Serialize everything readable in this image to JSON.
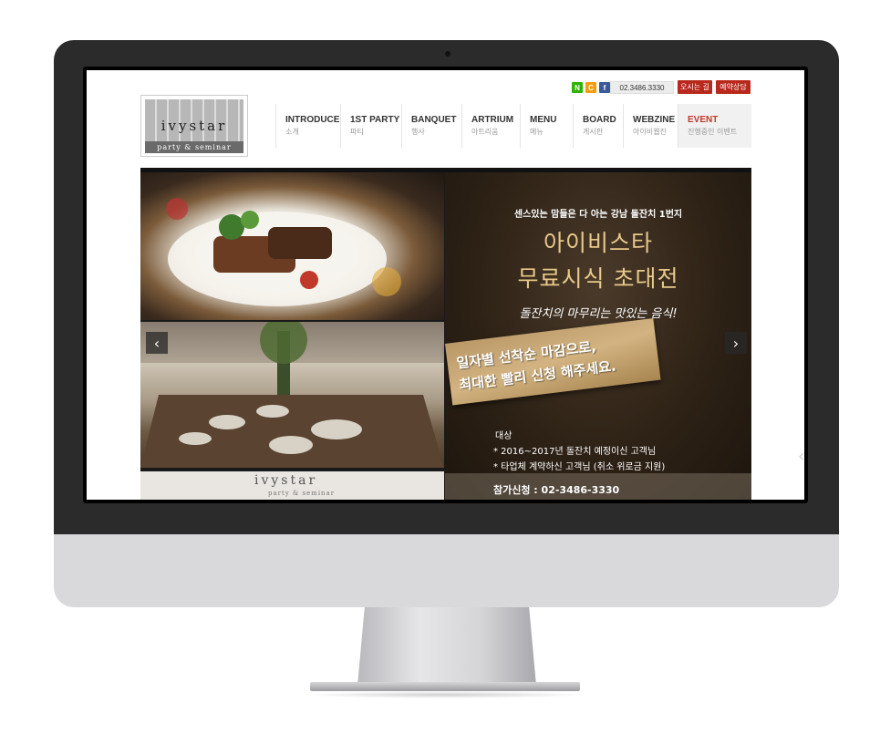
{
  "util": {
    "social": [
      {
        "label": "N",
        "icon": "naver-icon",
        "color": "#2db400"
      },
      {
        "label": "C",
        "icon": "cafe-icon",
        "color": "#f39c12"
      },
      {
        "label": "f",
        "icon": "facebook-icon",
        "color": "#3b5998"
      }
    ],
    "phone": "02.3486.3330",
    "directions_label": "오시는 길",
    "reservation_label": "예약상담"
  },
  "logo": {
    "wordmark": "ivystar",
    "tagline": "party & seminar"
  },
  "nav": [
    {
      "en": "INTRODUCE",
      "ko": "소개"
    },
    {
      "en": "1ST PARTY",
      "ko": "파티"
    },
    {
      "en": "BANQUET",
      "ko": "행사"
    },
    {
      "en": "ARTRIUM",
      "ko": "아트리움"
    },
    {
      "en": "MENU",
      "ko": "메뉴"
    },
    {
      "en": "BOARD",
      "ko": "게시판"
    },
    {
      "en": "WEBZINE",
      "ko": "아이비웹진"
    },
    {
      "en": "EVENT",
      "ko": "진행중인 이벤트"
    }
  ],
  "banner": {
    "headline_small": "센스있는 맘들은 다 아는 강남 돌잔치 1번지",
    "title_line1": "아이비스타",
    "title_line2": "무료시식 초대전",
    "subtitle": "돌잔치의 마무리는 맛있는 음식!",
    "ribbon_line1": "일자별 선착순 마감으로,",
    "ribbon_line2": "최대한 빨리 신청 해주세요.",
    "target_label": "대상",
    "target_item1": "* 2016~2017년 돌잔치 예정이신 고객님",
    "target_item2": "* 타업체 계약하신 고객님 (취소 위로금 지원)",
    "apply": "참가신청 : 02-3486-3330",
    "strip_text": "ivystar",
    "strip_sub": "party & seminar",
    "prev_label": "‹",
    "next_label": "›"
  },
  "colors": {
    "accent_red": "#b8281c",
    "gold_text": "#e8c98a",
    "event_red": "#c0392b"
  }
}
